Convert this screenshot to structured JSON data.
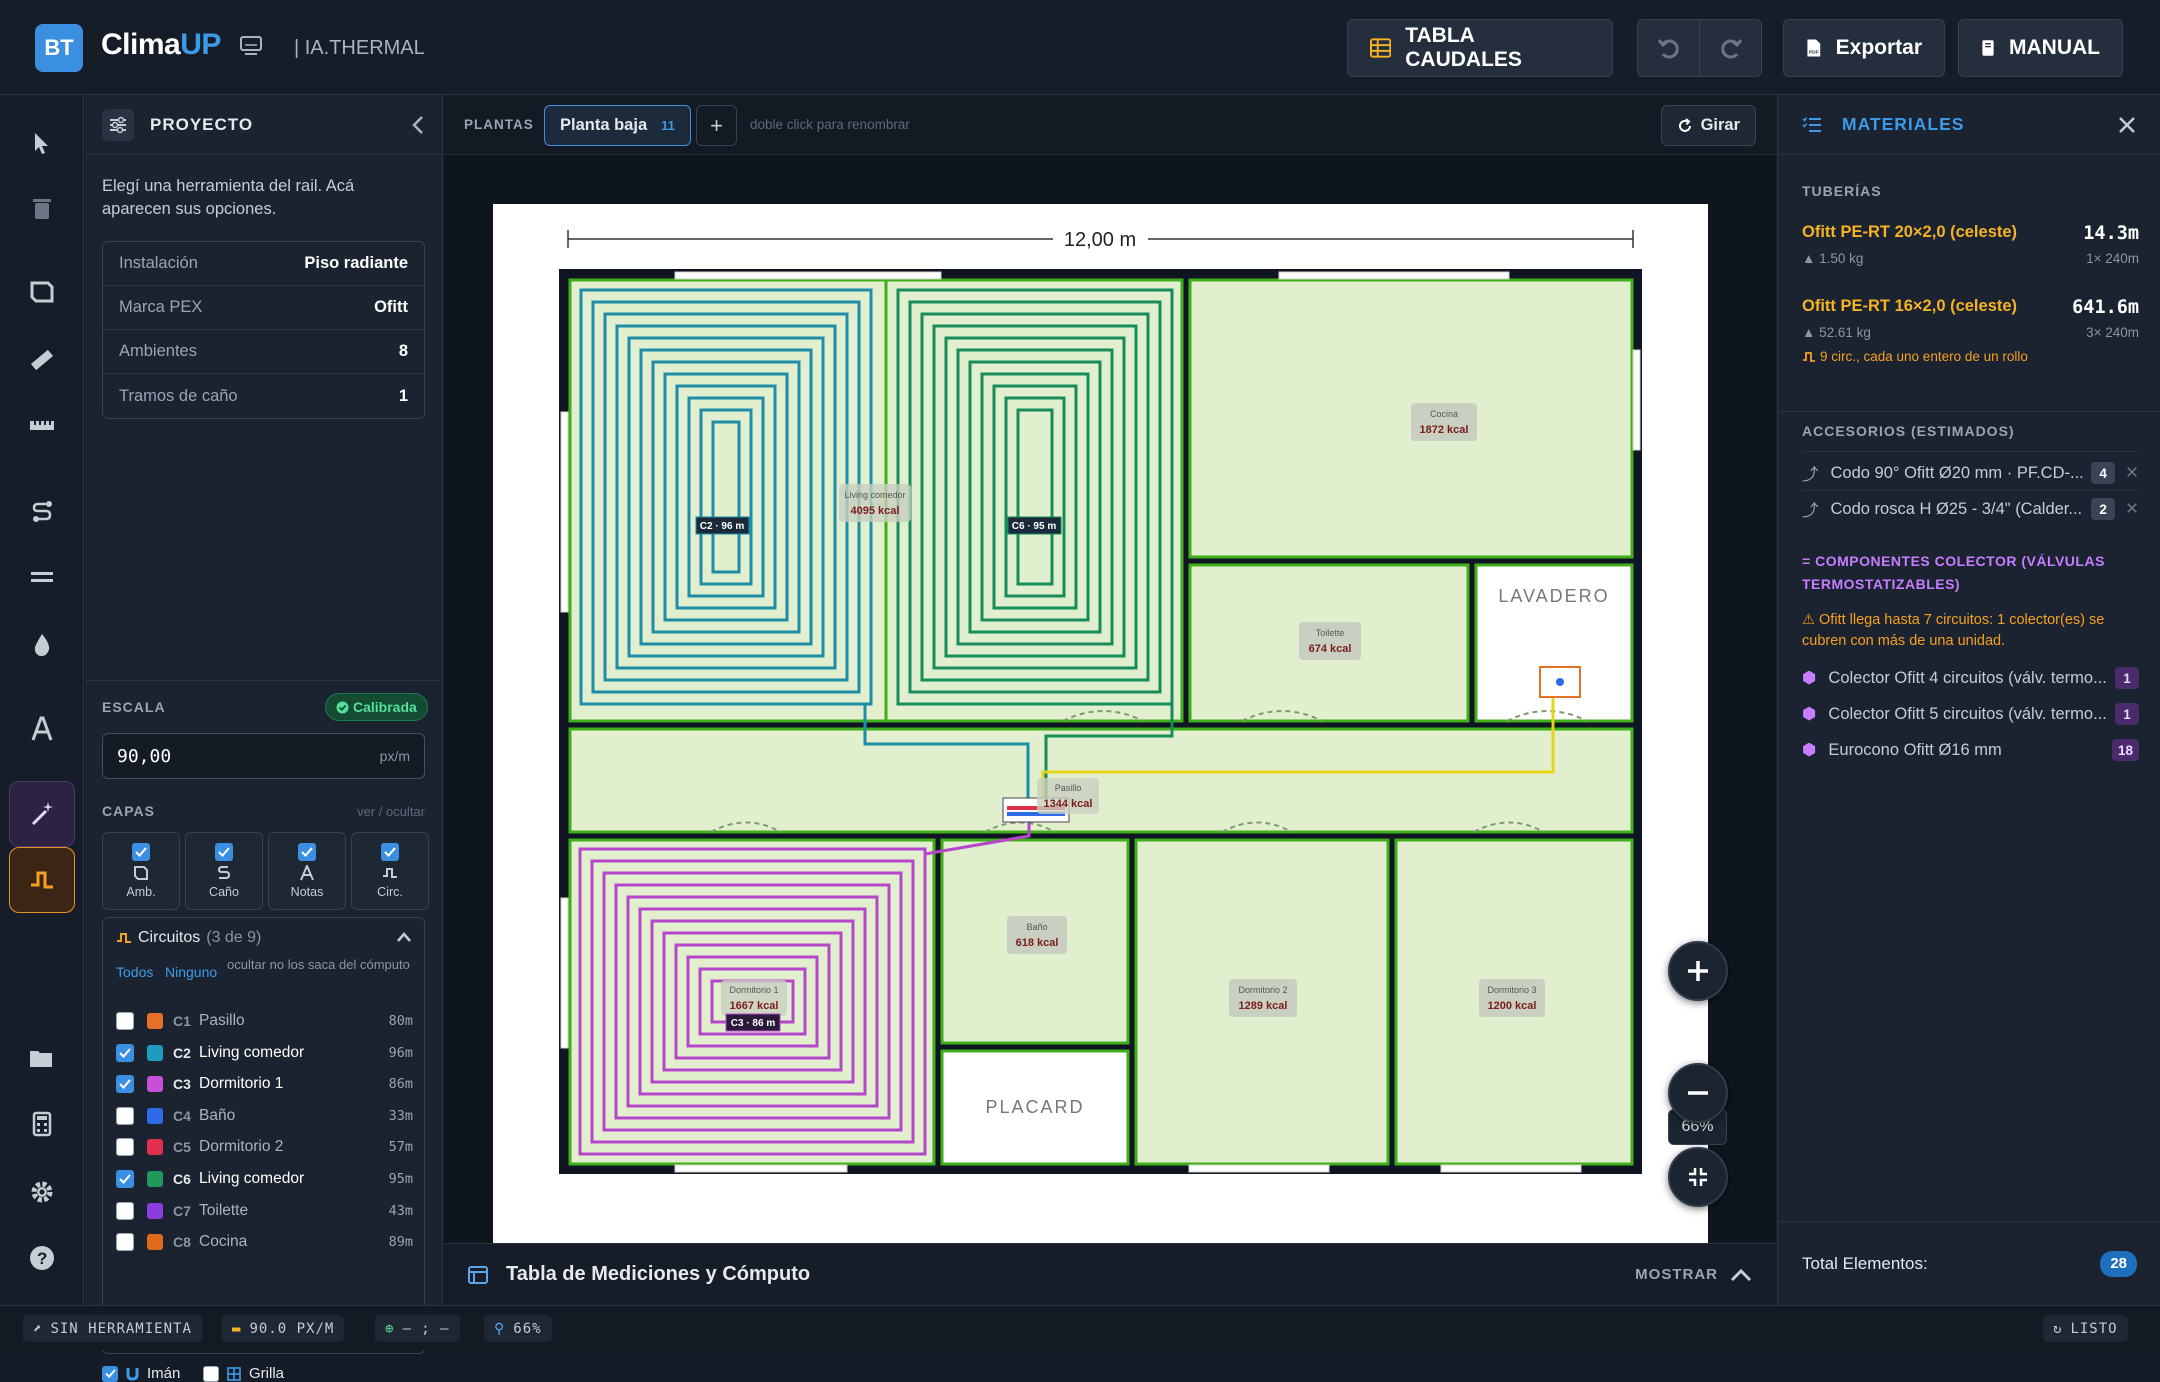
{
  "app": {
    "logo": "BT",
    "brand_main": "Clima",
    "brand_accent": "UP",
    "subtitle": "| IA.THERMAL",
    "accent": "#3b8fe0"
  },
  "toolbar": {
    "tabla_caudales": "TABLA CAUDALES",
    "exportar": "Exportar",
    "manual": "MANUAL"
  },
  "rail": {
    "icons": [
      "select-icon",
      "trash-icon",
      "room-icon",
      "ruler-icon",
      "measure-icon",
      "pipe-icon",
      "wall-icon",
      "drop-icon",
      "text-icon",
      "magic-icon",
      "circuit-icon",
      "folder-icon",
      "calculator-icon",
      "gear-icon",
      "help-icon"
    ]
  },
  "project": {
    "title": "PROYECTO",
    "description": "Elegí una herramienta del rail. Acá aparecen sus opciones.",
    "info": [
      {
        "k": "Instalación",
        "v": "Piso radiante"
      },
      {
        "k": "Marca PEX",
        "v": "Ofitt"
      },
      {
        "k": "Ambientes",
        "v": "8"
      },
      {
        "k": "Tramos de caño",
        "v": "1"
      }
    ],
    "escala_label": "ESCALA",
    "calibrada": "Calibrada",
    "escala_value": "90,00",
    "escala_unit": "px/m",
    "capas_label": "CAPAS",
    "capas_hint": "ver / ocultar",
    "capas": [
      "Amb.",
      "Caño",
      "Notas",
      "Circ."
    ],
    "circuitos_title": "Circuitos",
    "circuitos_count": "(3 de 9)",
    "todos": "Todos",
    "ninguno": "Ninguno",
    "circuitos_hint": "ocultar no los saca del cómputo",
    "circuits": [
      {
        "id": "C1",
        "name": "Pasillo",
        "len": "80m",
        "color": "#e8712a",
        "checked": false
      },
      {
        "id": "C2",
        "name": "Living comedor",
        "len": "96m",
        "color": "#1e9bbf",
        "checked": true
      },
      {
        "id": "C3",
        "name": "Dormitorio 1",
        "len": "86m",
        "color": "#c64fd6",
        "checked": true
      },
      {
        "id": "C4",
        "name": "Baño",
        "len": "33m",
        "color": "#2f6be8",
        "checked": false
      },
      {
        "id": "C5",
        "name": "Dormitorio 2",
        "len": "57m",
        "color": "#e0304e",
        "checked": false
      },
      {
        "id": "C6",
        "name": "Living comedor",
        "len": "95m",
        "color": "#1f9a5a",
        "checked": true
      },
      {
        "id": "C7",
        "name": "Toilette",
        "len": "43m",
        "color": "#8b3ee0",
        "checked": false
      },
      {
        "id": "C8",
        "name": "Cocina",
        "len": "89m",
        "color": "#e06a1a",
        "checked": false
      }
    ],
    "iman": "Imán",
    "grilla": "Grilla"
  },
  "plantas": {
    "label": "PLANTAS",
    "tab": "Planta baja",
    "tab_count": "11",
    "hint": "doble click para renombrar",
    "girar": "Girar"
  },
  "plan": {
    "dimension": "12,00 m",
    "rooms": [
      {
        "name": "Cocina",
        "kcal": "1872 kcal"
      },
      {
        "name": "Living comedor",
        "kcal": "4095 kcal"
      },
      {
        "name": "Toilette",
        "kcal": "674 kcal"
      },
      {
        "name": "Pasillo",
        "kcal": "1344 kcal"
      },
      {
        "name": "Baño",
        "kcal": "618 kcal"
      },
      {
        "name": "Dormitorio 1",
        "kcal": "1667 kcal"
      },
      {
        "name": "Dormitorio 2",
        "kcal": "1289 kcal"
      },
      {
        "name": "Dormitorio 3",
        "kcal": "1200 kcal"
      }
    ],
    "circuit_tags": [
      "C2 · 96 m",
      "C6 · 95 m",
      "C3 · 86 m"
    ],
    "labels": [
      "LAVADERO",
      "PLACARD"
    ],
    "zoom": "66%"
  },
  "mediciones": {
    "title": "Tabla de Mediciones y Cómputo",
    "mostrar": "MOSTRAR"
  },
  "materiales": {
    "title": "MATERIALES",
    "tuberias": "TUBERÍAS",
    "pipes": [
      {
        "name": "Ofitt PE-RT 20×2,0 (celeste)",
        "len": "14.3m",
        "kg": "1.50 kg",
        "rolls": "1× 240m"
      },
      {
        "name": "Ofitt PE-RT 16×2,0 (celeste)",
        "len": "641.6m",
        "kg": "52.61 kg",
        "rolls": "3× 240m"
      }
    ],
    "pipe_note": "9 circ., cada uno entero de un rollo",
    "accesorios": "ACCESORIOS (ESTIMADOS)",
    "acc": [
      {
        "name": "Codo 90° Ofitt Ø20 mm · PF.CD-...",
        "n": "4"
      },
      {
        "name": "Codo rosca H Ø25 - 3/4\" (Calder...",
        "n": "2"
      }
    ],
    "componentes": "COMPONENTES COLECTOR (VÁLVULAS TERMOSTATIZABLES)",
    "warning": "Ofitt llega hasta 7 circuitos: 1 colector(es) se cubren con más de una unidad.",
    "comps": [
      {
        "name": "Colector Ofitt 4 circuitos (válv. termo...",
        "n": "1"
      },
      {
        "name": "Colector Ofitt 5 circuitos (válv. termo...",
        "n": "1"
      },
      {
        "name": "Eurocono Ofitt Ø16 mm",
        "n": "18"
      }
    ],
    "total_label": "Total Elementos:",
    "total": "28"
  },
  "status": {
    "tool": "SIN HERRAMIENTA",
    "scale": "90.0 PX/M",
    "coords": "– ; –",
    "zoom": "66%",
    "state": "LISTO"
  }
}
